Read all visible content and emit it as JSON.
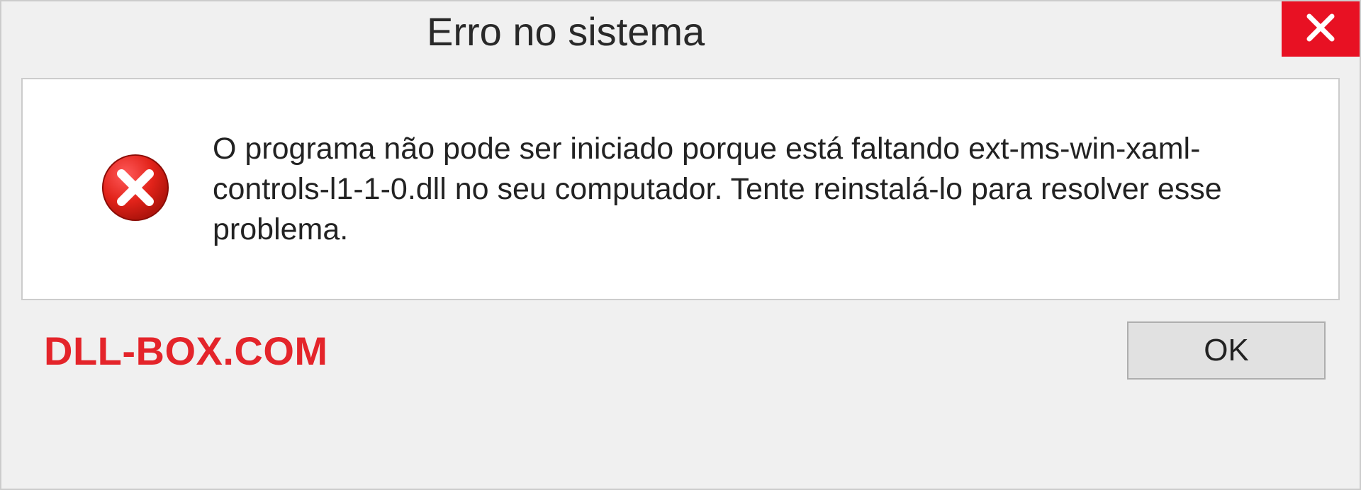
{
  "titlebar": {
    "title": "Erro no sistema"
  },
  "message": {
    "text": "O programa não pode ser iniciado porque está faltando ext-ms-win-xaml-controls-l1-1-0.dll no seu computador. Tente reinstalá-lo para resolver esse problema."
  },
  "footer": {
    "watermark": "DLL-BOX.COM",
    "ok_label": "OK"
  }
}
